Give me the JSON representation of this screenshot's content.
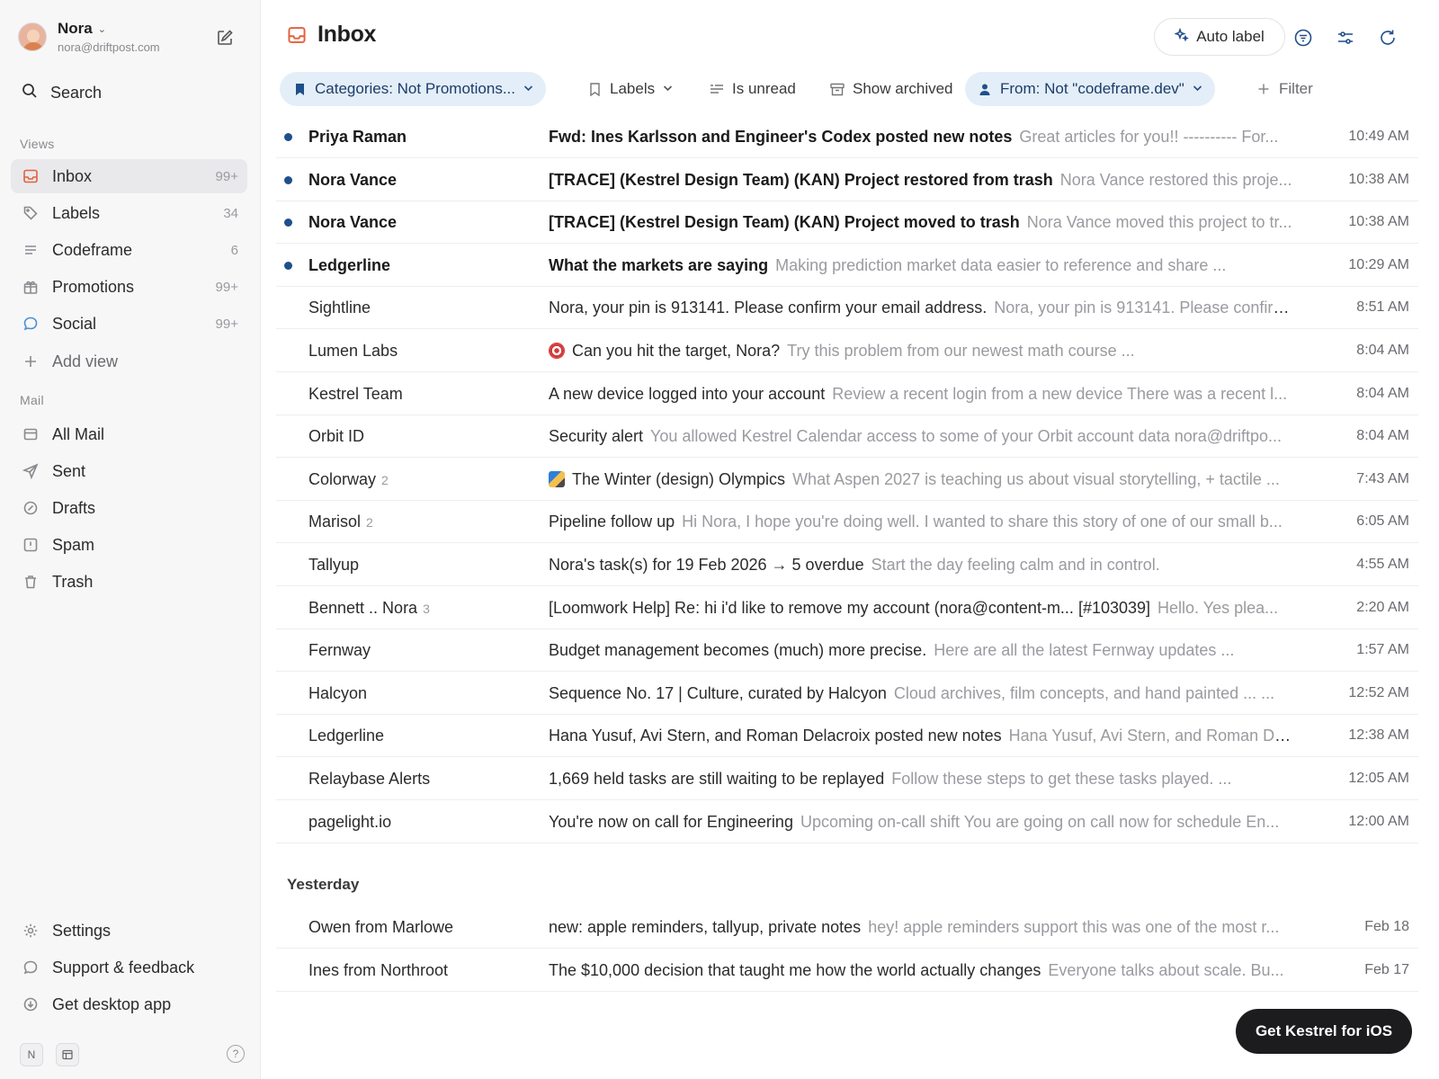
{
  "account": {
    "name": "Nora",
    "email": "nora@driftpost.com"
  },
  "search": {
    "label": "Search"
  },
  "sidebar": {
    "views_label": "Views",
    "views": [
      {
        "label": "Inbox",
        "count": "99+",
        "icon": "inbox-icon"
      },
      {
        "label": "Labels",
        "count": "34",
        "icon": "tag-icon"
      },
      {
        "label": "Codeframe",
        "count": "6",
        "icon": "list-icon"
      },
      {
        "label": "Promotions",
        "count": "99+",
        "icon": "gift-icon"
      },
      {
        "label": "Social",
        "count": "99+",
        "icon": "chat-bubble-icon"
      },
      {
        "label": "Add view",
        "count": "",
        "icon": "plus-icon"
      }
    ],
    "mail_label": "Mail",
    "mail": [
      {
        "label": "All Mail",
        "icon": "all-mail-icon"
      },
      {
        "label": "Sent",
        "icon": "send-icon"
      },
      {
        "label": "Drafts",
        "icon": "draft-icon"
      },
      {
        "label": "Spam",
        "icon": "spam-icon"
      },
      {
        "label": "Trash",
        "icon": "trash-icon"
      }
    ],
    "footer": [
      {
        "label": "Settings",
        "icon": "gear-icon"
      },
      {
        "label": "Support & feedback",
        "icon": "chat-bubble-icon"
      },
      {
        "label": "Get desktop app",
        "icon": "download-icon"
      }
    ],
    "tools": {
      "n_label": "N"
    }
  },
  "header": {
    "title": "Inbox",
    "auto_label": "Auto label"
  },
  "filters": [
    {
      "label": "Categories: Not Promotions...",
      "selected": true
    },
    {
      "label": "Labels",
      "selected": false
    },
    {
      "label": "Is unread",
      "selected": false
    },
    {
      "label": "Show archived",
      "selected": false
    },
    {
      "label": "From: Not \"codeframe.dev\"",
      "selected": true
    },
    {
      "label": "Filter",
      "selected": false
    }
  ],
  "emails_today": [
    {
      "sender": "Priya Raman",
      "thread": "",
      "subject": "Fwd: Ines Karlsson and Engineer's Codex posted new notes",
      "preview": "Great articles for you!! ---------- For...",
      "time": "10:49 AM",
      "unread": true
    },
    {
      "sender": "Nora Vance",
      "thread": "",
      "subject": "[TRACE] (Kestrel Design Team) (KAN) Project restored from trash",
      "preview": "Nora Vance restored this proje...",
      "time": "10:38 AM",
      "unread": true
    },
    {
      "sender": "Nora Vance",
      "thread": "",
      "subject": "[TRACE] (Kestrel Design Team) (KAN) Project moved to trash",
      "preview": "Nora Vance moved this project to tr...",
      "time": "10:38 AM",
      "unread": true
    },
    {
      "sender": "Ledgerline",
      "thread": "",
      "subject": "What the markets are saying",
      "preview": "Making prediction market data easier to reference and share ...",
      "time": "10:29 AM",
      "unread": true
    },
    {
      "sender": "Sightline",
      "thread": "",
      "subject": "Nora, your pin is 913141. Please confirm your email address.",
      "preview": "Nora, your pin is 913141. Please confirm...",
      "time": "8:51 AM",
      "unread": false
    },
    {
      "sender": "Lumen Labs",
      "thread": "",
      "subject": "Can you hit the target, Nora?",
      "preview": "Try this problem from our newest math course ...",
      "time": "8:04 AM",
      "unread": false,
      "emoji": "target"
    },
    {
      "sender": "Kestrel Team",
      "thread": "",
      "subject": "A new device logged into your account",
      "preview": "Review a recent login from a new device There was a recent l...",
      "time": "8:04 AM",
      "unread": false
    },
    {
      "sender": "Orbit ID",
      "thread": "",
      "subject": "Security alert",
      "preview": "You allowed Kestrel Calendar access to some of your Orbit account data nora@driftpo...",
      "time": "8:04 AM",
      "unread": false
    },
    {
      "sender": "Colorway",
      "thread": "2",
      "subject": "The Winter (design) Olympics",
      "preview": "What Aspen 2027 is teaching us about visual storytelling, + tactile ...",
      "time": "7:43 AM",
      "unread": false,
      "emoji": "skier"
    },
    {
      "sender": "Marisol",
      "thread": "2",
      "subject": "Pipeline follow up",
      "preview": "Hi Nora, I hope you're doing well. I wanted to share this story of one of our small b...",
      "time": "6:05 AM",
      "unread": false
    },
    {
      "sender": "Tallyup",
      "thread": "",
      "subject": "Nora's task(s) for 19 Feb 2026 → 5 overdue",
      "preview": "Start the day feeling calm and in control.",
      "time": "4:55 AM",
      "unread": false
    },
    {
      "sender": "Bennett .. Nora",
      "thread": "3",
      "subject": "[Loomwork Help] Re: hi i'd like to remove my account (nora@content-m... [#103039]",
      "preview": "Hello. Yes plea...",
      "time": "2:20 AM",
      "unread": false
    },
    {
      "sender": "Fernway",
      "thread": "",
      "subject": "Budget management becomes (much) more precise.",
      "preview": "Here are all the latest Fernway updates ...",
      "time": "1:57 AM",
      "unread": false
    },
    {
      "sender": "Halcyon",
      "thread": "",
      "subject": "Sequence No. 17 | Culture, curated by Halcyon",
      "preview": "Cloud archives, film concepts, and hand painted ... ...",
      "time": "12:52 AM",
      "unread": false
    },
    {
      "sender": "Ledgerline",
      "thread": "",
      "subject": "Hana Yusuf, Avi Stern, and Roman Delacroix posted new notes",
      "preview": "Hana Yusuf, Avi Stern, and Roman De...",
      "time": "12:38 AM",
      "unread": false
    },
    {
      "sender": "Relaybase Alerts",
      "thread": "",
      "subject": "1,669 held tasks are still waiting to be replayed",
      "preview": "Follow these steps to get these tasks played. ...",
      "time": "12:05 AM",
      "unread": false
    },
    {
      "sender": "pagelight.io",
      "thread": "",
      "subject": "You're now on call for Engineering",
      "preview": "Upcoming on-call shift You are going on call now for schedule En...",
      "time": "12:00 AM",
      "unread": false
    }
  ],
  "yesterday_label": "Yesterday",
  "emails_yesterday": [
    {
      "sender": "Owen from Marlowe",
      "thread": "",
      "subject": "new: apple reminders, tallyup, private notes",
      "preview": "hey! apple reminders support this was one of the most r...",
      "time": "Feb 18",
      "unread": false
    },
    {
      "sender": "Ines from Northroot",
      "thread": "",
      "subject": "The $10,000 decision that taught me how the world actually changes",
      "preview": "Everyone talks about scale. Bu...",
      "time": "Feb 17",
      "unread": false
    }
  ],
  "ios_button": "Get Kestrel for iOS",
  "colors": {
    "accent": "#e2613b",
    "unread_dot": "#1f4f8a",
    "chip_selected_bg": "#e4eef8",
    "ios_button_bg": "#1c1c1e"
  }
}
